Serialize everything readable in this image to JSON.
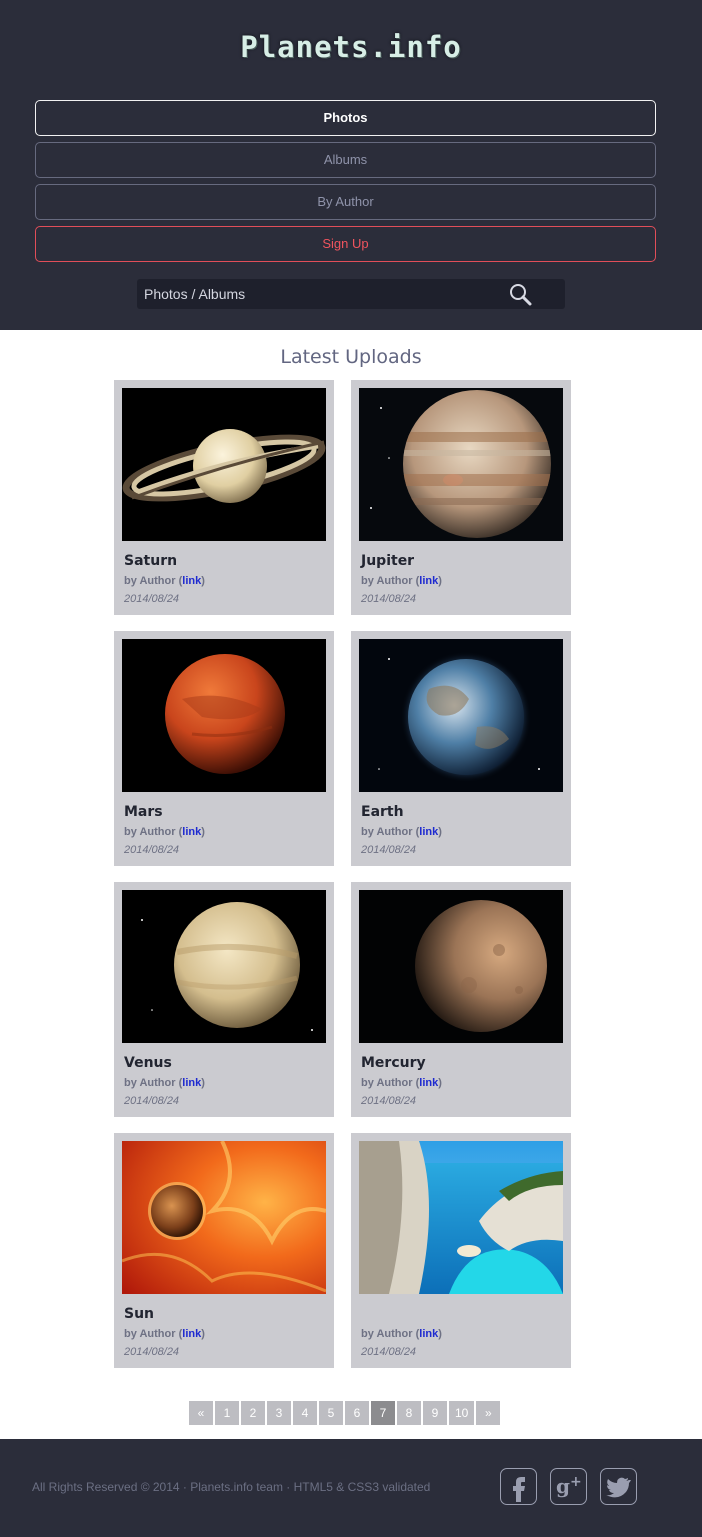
{
  "site": {
    "logo": "Planets.info"
  },
  "nav": {
    "items": [
      {
        "label": "Photos"
      },
      {
        "label": "Albums"
      },
      {
        "label": "By Author"
      },
      {
        "label": "Sign Up"
      }
    ]
  },
  "search": {
    "placeholder": "Photos / Albums"
  },
  "main": {
    "title": "Latest Uploads",
    "cards": [
      {
        "title": "Saturn",
        "author": "by Author",
        "link": "link",
        "date": "2014/08/24"
      },
      {
        "title": "Jupiter",
        "author": "by Author",
        "link": "link",
        "date": "2014/08/24"
      },
      {
        "title": "Mars",
        "author": "by Author",
        "link": "link",
        "date": "2014/08/24"
      },
      {
        "title": "Earth",
        "author": "by Author",
        "link": "link",
        "date": "2014/08/24"
      },
      {
        "title": "Venus",
        "author": "by Author",
        "link": "link",
        "date": "2014/08/24"
      },
      {
        "title": "Mercury",
        "author": "by Author",
        "link": "link",
        "date": "2014/08/24"
      },
      {
        "title": "Sun",
        "author": "by Author",
        "link": "link",
        "date": "2014/08/24"
      },
      {
        "title": "",
        "author": "by Author",
        "link": "link",
        "date": "2014/08/24"
      }
    ]
  },
  "pagination": {
    "prev": "«",
    "pages": [
      "1",
      "2",
      "3",
      "4",
      "5",
      "6",
      "7",
      "8",
      "9",
      "10"
    ],
    "current": "7",
    "next": "»"
  },
  "footer": {
    "copyright": "All Rights Reserved © 2014 · Planets.info team · HTML5 & CSS3 validated",
    "social": [
      "facebook-icon",
      "google-plus-icon",
      "twitter-icon"
    ]
  },
  "colors": {
    "header_bg": "#2b2d3a",
    "signup_accent": "#e14e59",
    "card_bg": "#cbcbd0",
    "link": "#1e2ad0"
  }
}
